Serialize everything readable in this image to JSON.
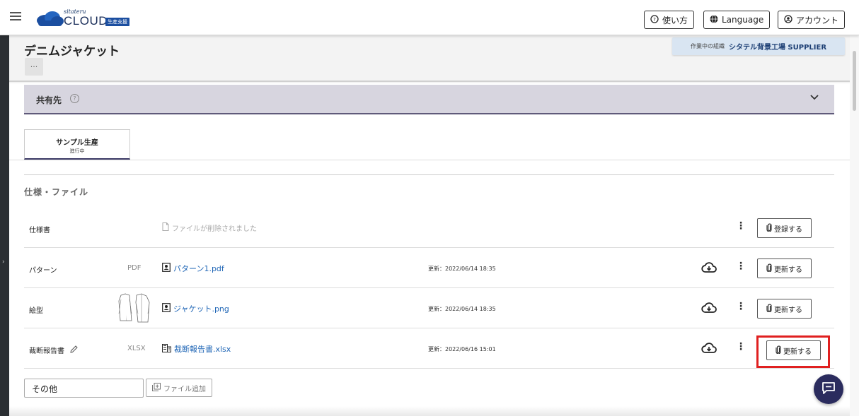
{
  "header": {
    "logo_small": "sitateru",
    "logo_text": "CLOUD",
    "logo_badge": "生産支援",
    "help_label": "使い方",
    "language_label": "Language",
    "account_label": "アカウント"
  },
  "page": {
    "title": "デニムジャケット",
    "more_label": "···",
    "org_label": "作業中の組織",
    "org_name": "シタテル背景工場 SUPPLIER"
  },
  "share": {
    "label": "共有先",
    "help": "?"
  },
  "tabs": [
    {
      "title": "サンプル生産",
      "status": "進行中"
    }
  ],
  "section": {
    "title": "仕様・ファイル"
  },
  "rows": [
    {
      "name": "仕様書",
      "type": "",
      "file": "ファイルが削除されました",
      "updated": "",
      "action": "登録する"
    },
    {
      "name": "パターン",
      "type": "PDF",
      "file": "パターン1.pdf",
      "updated": "更新：2022/06/14 18:35",
      "action": "更新する"
    },
    {
      "name": "絵型",
      "type": "",
      "file": "ジャケット.png",
      "updated": "更新：2022/06/14 18:35",
      "action": "更新する"
    },
    {
      "name": "裁断報告書",
      "type": "XLSX",
      "file": "裁断報告書.xlsx",
      "updated": "更新：2022/06/16 15:01",
      "action": "更新する"
    }
  ],
  "footer": {
    "other_value": "その他",
    "add_file_label": "ファイル追加"
  },
  "colors": {
    "accent": "#2b2c5e",
    "link": "#1d64b5",
    "highlight": "#e02020"
  }
}
